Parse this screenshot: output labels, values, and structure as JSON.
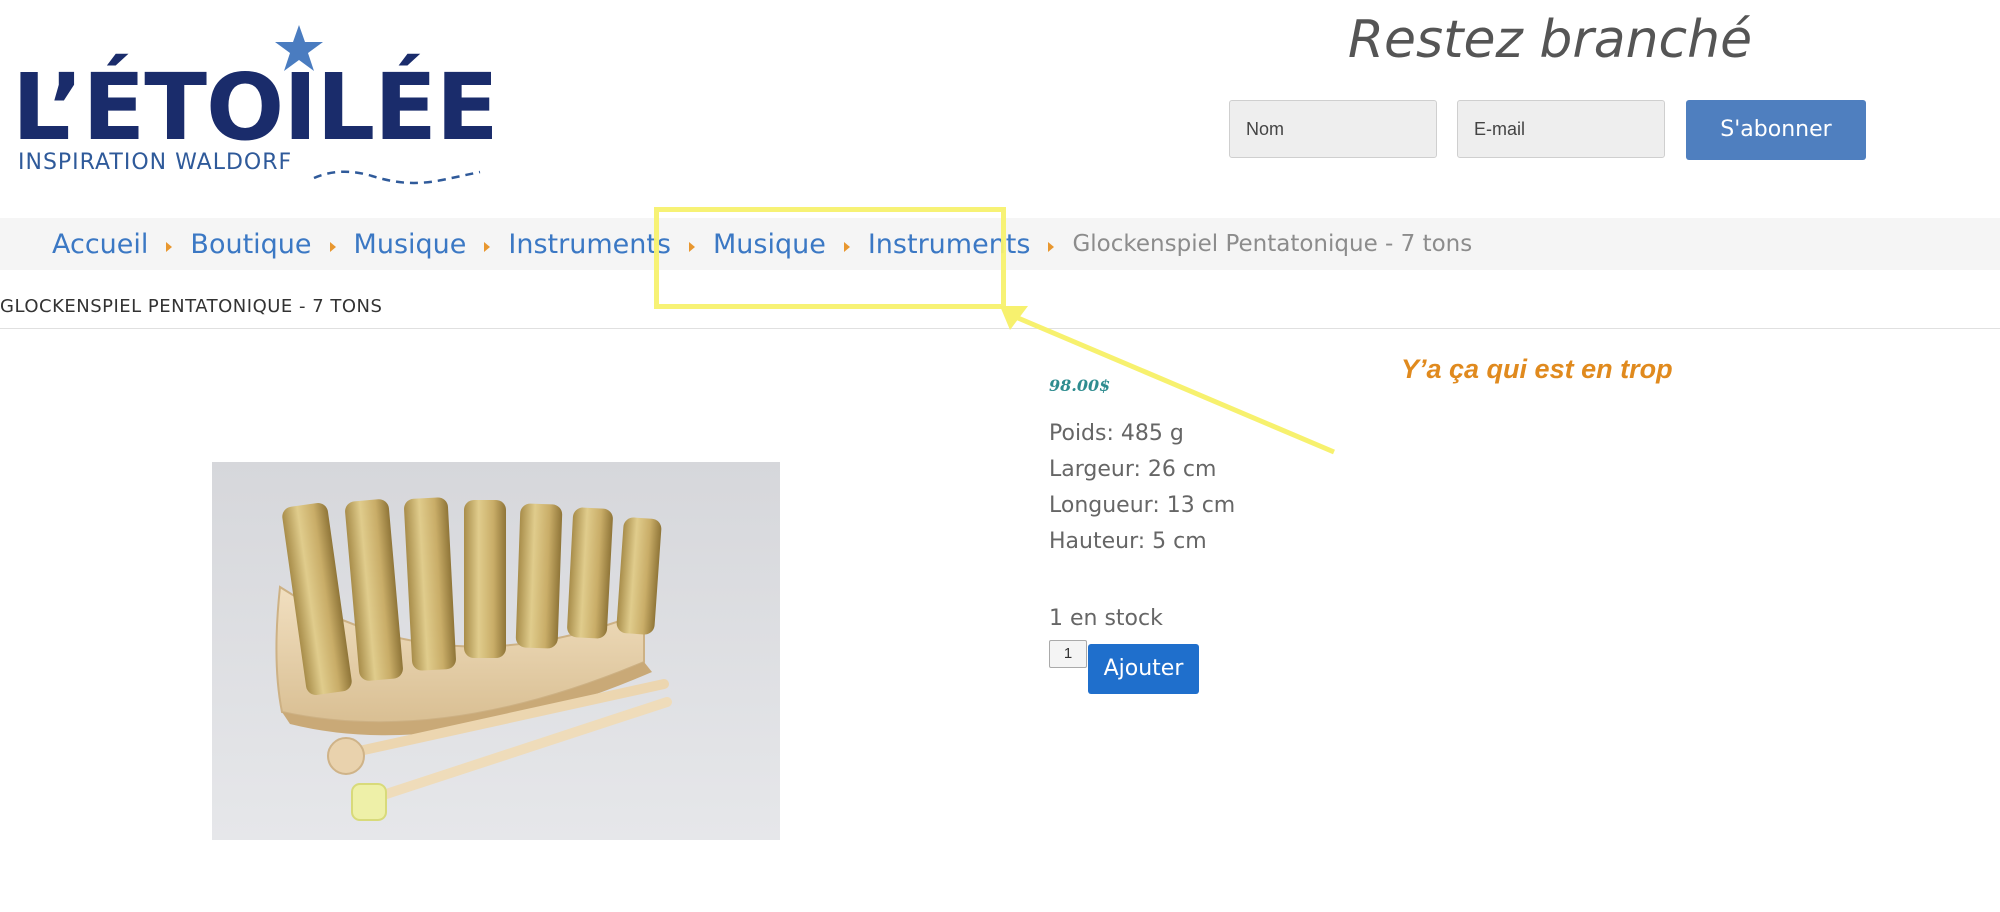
{
  "logo": {
    "title": "L’ÉTOILÉE",
    "subtitle": "INSPIRATION WALDORF",
    "icon": "star-icon"
  },
  "newsletter": {
    "title": "Restez branché",
    "name_value": "Nom",
    "email_value": "E-mail",
    "button_label": "S'abonner"
  },
  "breadcrumb": {
    "items": [
      "Accueil",
      "Boutique",
      "Musique",
      "Instruments",
      "Musique",
      "Instruments"
    ],
    "current": "Glockenspiel Pentatonique - 7 tons",
    "separator_color": "#e8972f"
  },
  "product": {
    "title": "GLOCKENSPIEL PENTATONIQUE - 7 TONS",
    "price": "98.00$",
    "specs": [
      "Poids: 485 g",
      "Largeur: 26 cm",
      "Longueur: 13 cm",
      "Hauteur: 5 cm"
    ],
    "stock": "1 en stock",
    "quantity": "1",
    "add_label": "Ajouter"
  },
  "annotation": {
    "note": "Y’a ça qui est en trop",
    "highlight_color": "#f7f16e",
    "note_color": "#e08a1e"
  },
  "colors": {
    "link": "#3b78c4",
    "button": "#1f6fcc",
    "subscribe": "#4f7fbf",
    "price": "#2e8c8f"
  }
}
